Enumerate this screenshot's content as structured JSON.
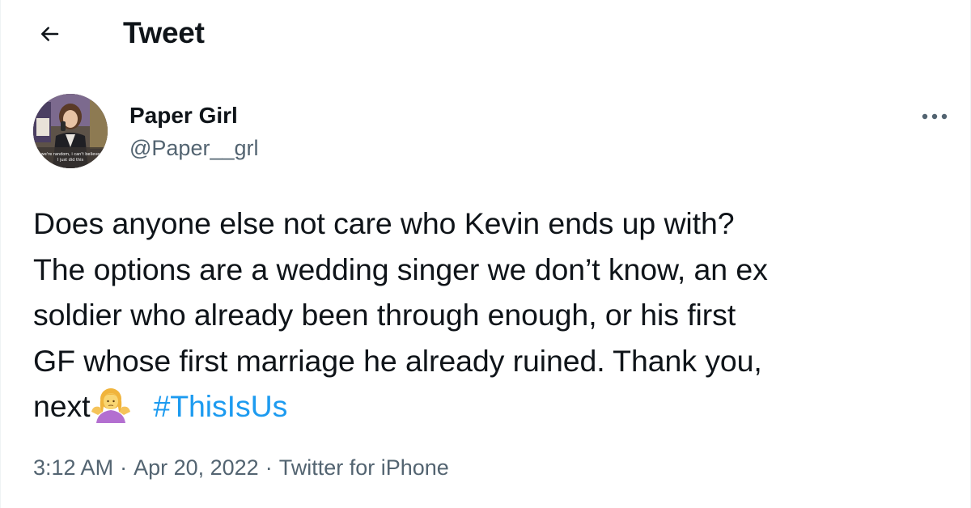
{
  "header": {
    "title": "Tweet",
    "back_icon": "arrow-left-icon"
  },
  "author": {
    "display_name": "Paper Girl",
    "handle": "@Paper__grl",
    "avatar_caption": "we're random, i can't believe I just did this",
    "more_icon": "more-horizontal-icon"
  },
  "tweet": {
    "line1": "Does anyone else not care who Kevin ends up with?",
    "line2": "The options are a wedding singer we don’t know, an ex",
    "line3": "soldier who already been through enough, or his first",
    "line4": "GF whose first marriage he already ruined. Thank you,",
    "line5_text": "next",
    "emoji": "person-shrugging-emoji",
    "hashtag": "#ThisIsUs"
  },
  "meta": {
    "time": "3:12 AM",
    "date": "Apr 20, 2022",
    "source": "Twitter for iPhone",
    "separator": "·"
  },
  "colors": {
    "text": "#0f1419",
    "secondary": "#536471",
    "link": "#1d9bf0"
  }
}
